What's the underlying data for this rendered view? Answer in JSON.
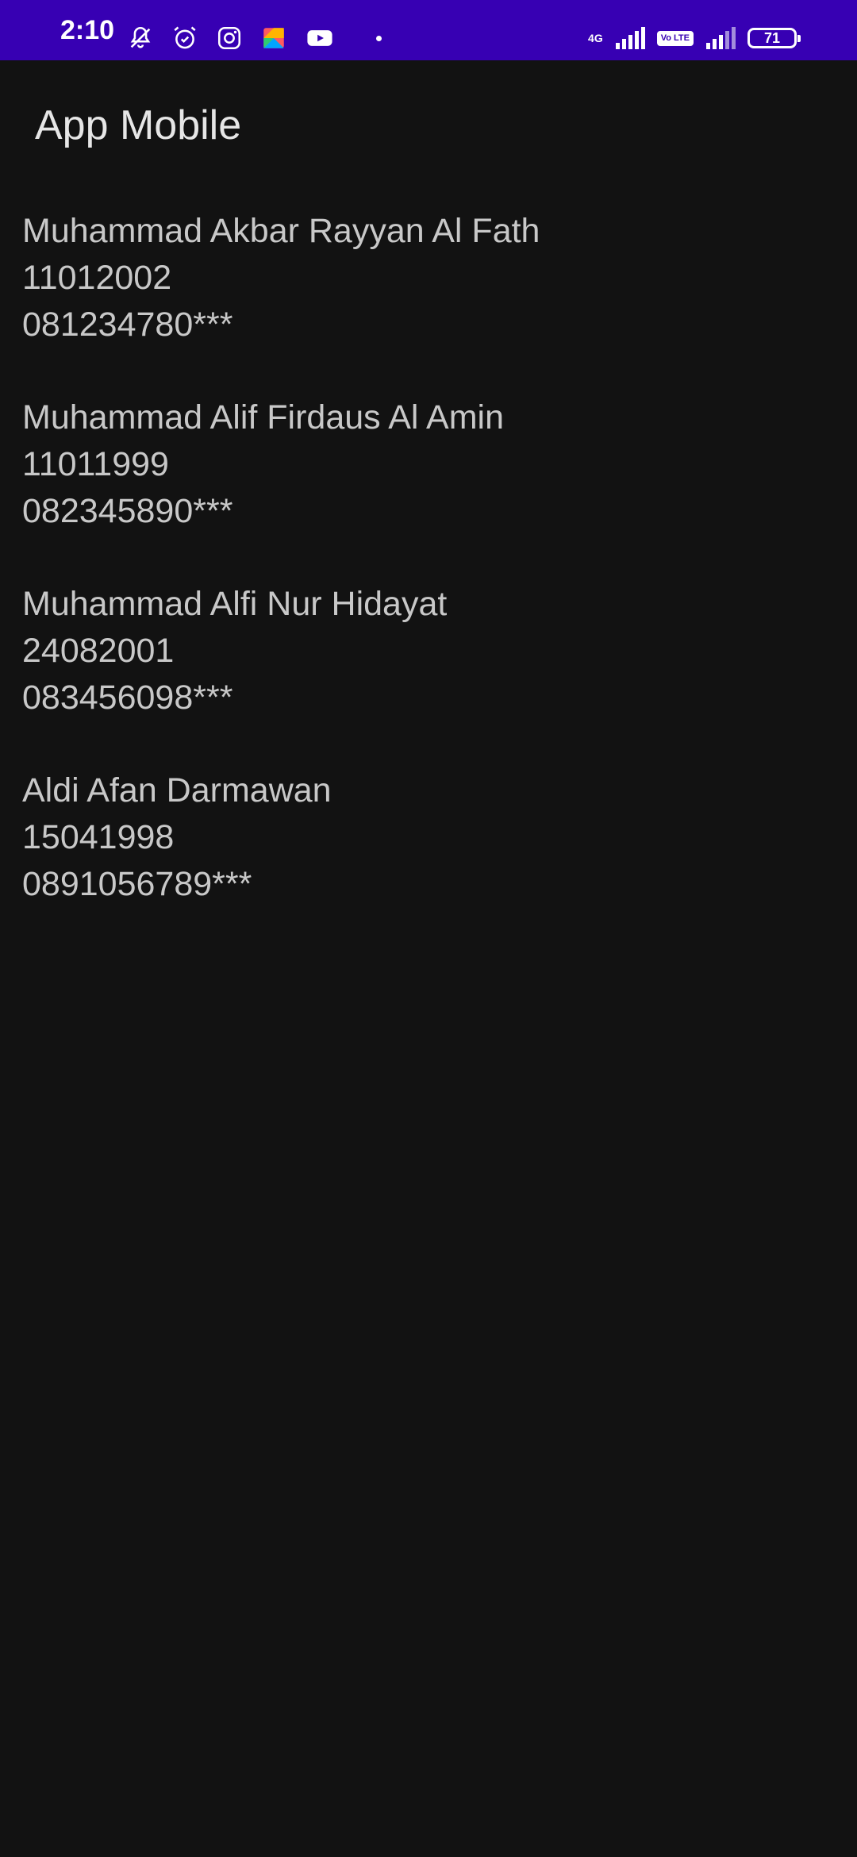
{
  "status_bar": {
    "time": "2:10",
    "icons_left": [
      "notifications-off-icon",
      "alarm-icon",
      "instagram-icon",
      "app-icon",
      "youtube-icon",
      "dot-icon"
    ],
    "network_type": "4G",
    "volte_label": "Vo LTE",
    "battery_level": "71",
    "background_color": "#3700b3"
  },
  "app_bar": {
    "title": "App Mobile"
  },
  "entries": [
    {
      "name": "Muhammad Akbar Rayyan Al Fath",
      "id": "11012002",
      "phone": "081234780***"
    },
    {
      "name": "Muhammad Alif Firdaus Al Amin",
      "id": "11011999",
      "phone": "082345890***"
    },
    {
      "name": "Muhammad Alfi Nur Hidayat",
      "id": "24082001",
      "phone": "083456098***"
    },
    {
      "name": "Aldi Afan Darmawan",
      "id": "15041998",
      "phone": "0891056789***"
    }
  ],
  "colors": {
    "background": "#121212",
    "text": "#c8c8c8",
    "title": "#e6e6e6"
  }
}
